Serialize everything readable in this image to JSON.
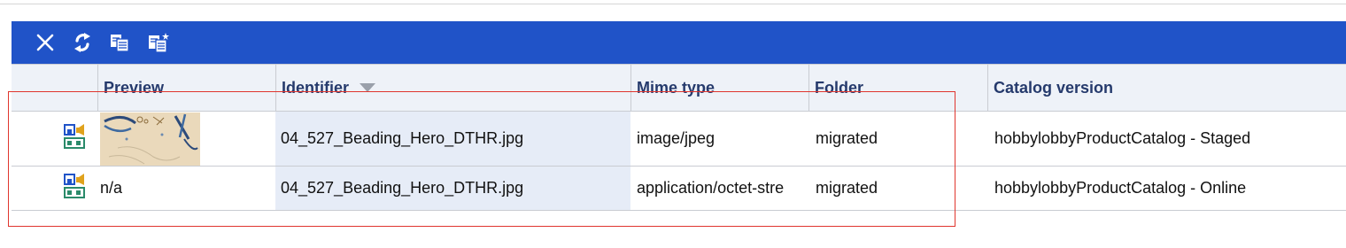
{
  "toolbar": {
    "buttons": [
      {
        "icon": "close-icon"
      },
      {
        "icon": "refresh-icon"
      },
      {
        "icon": "copy-icon"
      },
      {
        "icon": "paste-new-icon"
      }
    ],
    "color": "#2053c8"
  },
  "table": {
    "columns": [
      "",
      "Preview",
      "Identifier",
      "Mime type",
      "Folder",
      "Catalog version"
    ],
    "sorted_column": "Identifier",
    "sort_direction": "descending",
    "rows": [
      {
        "icon": "media-item-icon",
        "preview": "",
        "identifier": "04_527_Beading_Hero_DTHR.jpg",
        "mime_type": "image/jpeg",
        "folder": "migrated",
        "catalog_version": "hobbylobbyProductCatalog - Staged"
      },
      {
        "icon": "media-item-icon",
        "preview": "n/a",
        "identifier": "04_527_Beading_Hero_DTHR.jpg",
        "mime_type": "application/octet-stre",
        "folder": "migrated",
        "catalog_version": "hobbylobbyProductCatalog - Online"
      }
    ]
  },
  "colors": {
    "header_text": "#253a6c",
    "selection_outline": "#e0352e",
    "identifier_column_bg": "#e6ecf7"
  }
}
